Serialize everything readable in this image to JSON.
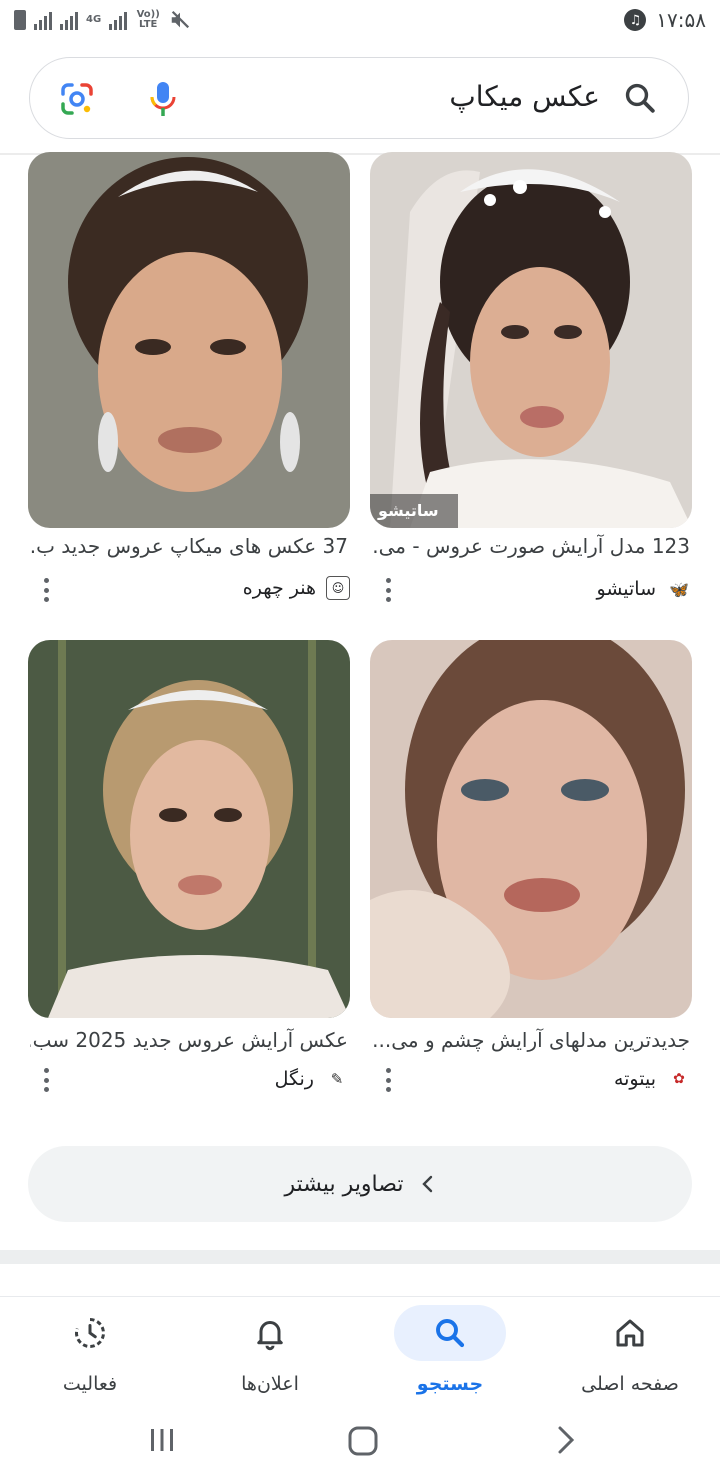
{
  "status_bar": {
    "time": "۱۷:۵۸",
    "network_type": "4G",
    "volte_label": "Vo)) LTE"
  },
  "search": {
    "query": "عکس میکاپ"
  },
  "results": [
    {
      "title": "123 مدل آرایش صورت عروس - می...",
      "source": "ساتیشو",
      "source_icon": "butterfly-icon",
      "watermark": "ساتیشو",
      "palette": [
        "#d9d4cf",
        "#3a2a25",
        "#d8a88c"
      ]
    },
    {
      "title": "37 عکس های میکاپ عروس جدید ب...",
      "source": "هنر چهره",
      "source_icon": "face-logo-icon",
      "palette": [
        "#8a8a80",
        "#3b2b22",
        "#d9a98a"
      ]
    },
    {
      "title": "جدیدترین مدلهای آرایش چشم و می...",
      "source": "بیتوته",
      "source_icon": "bitote-logo-icon",
      "palette": [
        "#d8c7bd",
        "#6b4a3a",
        "#e0b7a4"
      ]
    },
    {
      "title": "عکس آرایش عروس جدید 2025 سب...",
      "source": "رنگل",
      "source_icon": "rangel-logo-icon",
      "palette": [
        "#4c5a44",
        "#b89a70",
        "#e2b9a0"
      ]
    }
  ],
  "more_images": {
    "label": "تصاویر بیشتر"
  },
  "bottom_nav": [
    {
      "label": "صفحه اصلی",
      "icon": "home-icon",
      "active": false
    },
    {
      "label": "جستجو",
      "icon": "search-icon",
      "active": true
    },
    {
      "label": "اعلان‌ها",
      "icon": "bell-icon",
      "active": false
    },
    {
      "label": "فعالیت",
      "icon": "activity-icon",
      "active": false
    }
  ],
  "colors": {
    "accent": "#1a73e8",
    "active_nav_bg": "#e8f0fe"
  }
}
